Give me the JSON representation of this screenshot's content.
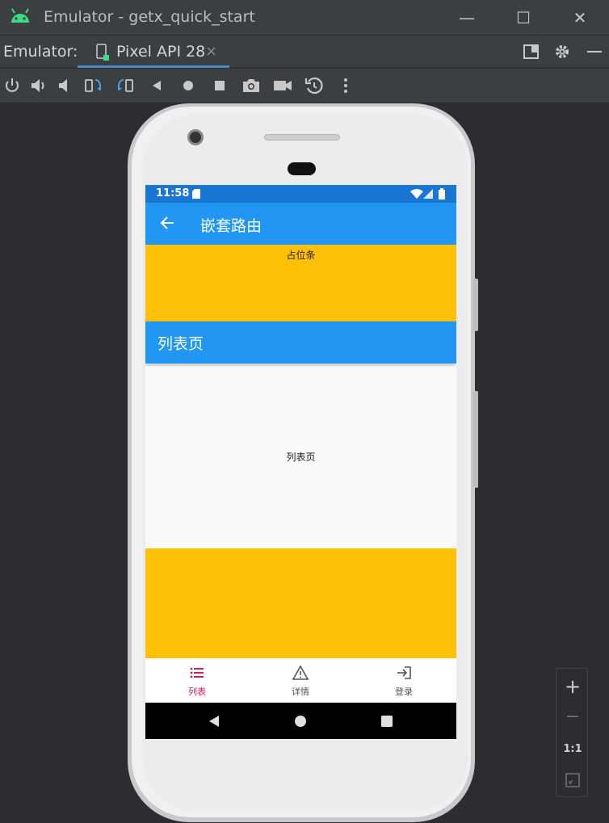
{
  "window": {
    "title": "Emulator - getx_quick_start",
    "minimize_glyph": "—",
    "maximize_glyph": "☐",
    "close_glyph": "✕"
  },
  "tabbar": {
    "label": "Emulator:",
    "tab_label": "Pixel API 28",
    "tab_close": "×"
  },
  "toolbar": {
    "icons": [
      "power-icon",
      "volume-up-icon",
      "volume-down-icon",
      "rotate-left-icon",
      "rotate-right-icon",
      "back-icon",
      "home-icon",
      "overview-icon",
      "screenshot-icon",
      "screen-record-icon",
      "snapshot-icon",
      "more-icon"
    ]
  },
  "device": {
    "status_time": "11:58",
    "appbar_title": "嵌套路由",
    "placeholder_text": "占位条",
    "list_header": "列表页",
    "list_body": "列表页",
    "nav": [
      {
        "label": "列表",
        "icon": "list-icon",
        "active": true
      },
      {
        "label": "详情",
        "icon": "warning-icon",
        "active": false
      },
      {
        "label": "登录",
        "icon": "login-icon",
        "active": false
      }
    ],
    "colors": {
      "status": "#1976d2",
      "appbar": "#2196f3",
      "placeholder": "#ffc107",
      "active_nav": "#d81b60",
      "inactive_nav": "#555555"
    }
  },
  "zoom": {
    "zoom_in": "+",
    "zoom_out": "−",
    "actual_size": "1:1"
  }
}
